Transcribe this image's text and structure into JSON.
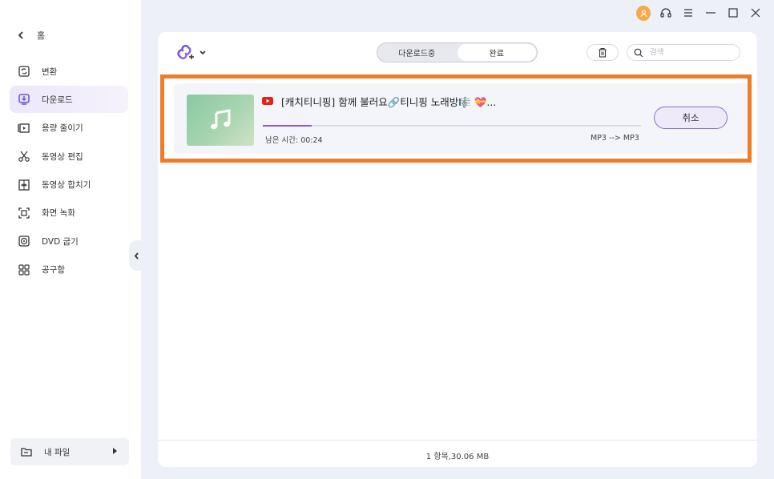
{
  "sidebar": {
    "back_label": "홈",
    "items": [
      {
        "label": "변환",
        "icon": "convert-icon"
      },
      {
        "label": "다운로드",
        "icon": "download-icon",
        "active": true
      },
      {
        "label": "용량 줄이기",
        "icon": "compress-icon"
      },
      {
        "label": "동영상 편집",
        "icon": "scissors-icon"
      },
      {
        "label": "동영상 합치기",
        "icon": "merge-icon"
      },
      {
        "label": "화면 녹화",
        "icon": "screen-record-icon"
      },
      {
        "label": "DVD 굽기",
        "icon": "disc-icon"
      },
      {
        "label": "공구함",
        "icon": "toolbox-icon"
      }
    ],
    "my_files_label": "내 파일"
  },
  "toolbar": {
    "tabs": [
      {
        "label": "다운로드중",
        "active": false
      },
      {
        "label": "완료",
        "active": true
      }
    ],
    "search_placeholder": "검색"
  },
  "download_item": {
    "title": "[캐치티니핑] 함께 불러요🔗티니핑 노래방🎼 💝...",
    "progress": 0.13,
    "remaining": "남은 시간: 00:24",
    "format": "MP3 --> MP3",
    "cancel_label": "취소"
  },
  "footer": {
    "summary": "1 항목,30.06 MB"
  },
  "colors": {
    "accent": "#8b5bd6",
    "highlight": "#f07c27",
    "avatar": "#f6a94b",
    "youtube": "#e62117"
  }
}
